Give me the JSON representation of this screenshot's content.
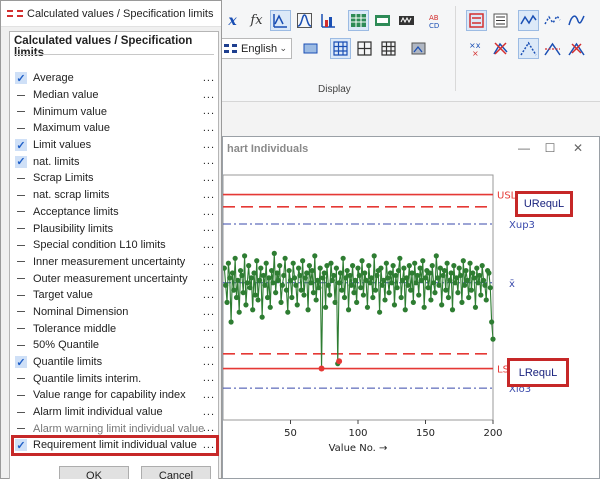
{
  "dialog": {
    "title": "Calculated values / Specification limits",
    "heading": "Calculated values / Specification limits",
    "more_glyph": "...",
    "options": [
      {
        "label": "Average",
        "checked": true
      },
      {
        "label": "Median value",
        "checked": false
      },
      {
        "label": "Minimum value",
        "checked": false
      },
      {
        "label": "Maximum value",
        "checked": false
      },
      {
        "label": "Limit values",
        "checked": true
      },
      {
        "label": "nat. limits",
        "checked": true
      },
      {
        "label": "Scrap Limits",
        "checked": false
      },
      {
        "label": "nat. scrap limits",
        "checked": false
      },
      {
        "label": "Acceptance limits",
        "checked": false
      },
      {
        "label": "Plausibility limits",
        "checked": false
      },
      {
        "label": "Special condition L10 limits",
        "checked": false
      },
      {
        "label": "Inner measurement uncertainty",
        "checked": false
      },
      {
        "label": "Outer measurement uncertainty",
        "checked": false
      },
      {
        "label": "Target value",
        "checked": false
      },
      {
        "label": "Nominal Dimension",
        "checked": false
      },
      {
        "label": "Tolerance middle",
        "checked": false
      },
      {
        "label": "50% Quantile",
        "checked": false
      },
      {
        "label": "Quantile limits",
        "checked": true
      },
      {
        "label": "Quantile limits interim.",
        "checked": false
      },
      {
        "label": "Value range for capability index",
        "checked": false
      },
      {
        "label": "Alarm limit individual value",
        "checked": false
      },
      {
        "label": "Alarm warning limit individual value",
        "checked": false
      },
      {
        "label": "Requirement limit individual value",
        "checked": true
      }
    ],
    "ok_label": "OK",
    "cancel_label": "Cancel"
  },
  "ribbon": {
    "language": "English",
    "group_label": "Display",
    "x_label": "x",
    "fx_label": "fx"
  },
  "chart_window": {
    "title": "hart Individuals",
    "minimize": "—",
    "maximize": "☐",
    "close": "✕"
  },
  "callouts": {
    "upper": "URequL",
    "lower": "LRequL"
  },
  "chart_data": {
    "type": "line",
    "xlabel": "Value No. →",
    "x_ticks": [
      50,
      100,
      150,
      200
    ],
    "xlim": [
      0,
      200
    ],
    "ylim": [
      0,
      100
    ],
    "lines": [
      {
        "label": "USL",
        "y": 92,
        "style": "solid",
        "color": "#e53935"
      },
      {
        "label": "",
        "y": 87,
        "style": "dashed",
        "color": "#e53935"
      },
      {
        "label": "Xup3",
        "y": 80,
        "style": "dashdot",
        "color": "#3949ab"
      },
      {
        "label": "x̄",
        "y": 56,
        "style": "dashdot",
        "color": "#3949ab"
      },
      {
        "label": "",
        "y": 27,
        "style": "dashed",
        "color": "#e53935"
      },
      {
        "label": "LSL",
        "y": 21,
        "style": "solid",
        "color": "#e53935"
      },
      {
        "label": "Xlo3",
        "y": 13,
        "style": "dashdot",
        "color": "#3949ab"
      }
    ],
    "series": [
      {
        "name": "",
        "color": "#2e7d32",
        "values": [
          62,
          55,
          48,
          64,
          58,
          40,
          60,
          53,
          66,
          50,
          57,
          44,
          61,
          59,
          52,
          67,
          47,
          56,
          63,
          54,
          58,
          45,
          60,
          51,
          65,
          49,
          57,
          62,
          42,
          59,
          55,
          64,
          50,
          58,
          46,
          61,
          56,
          68,
          52,
          60,
          57,
          63,
          48,
          55,
          59,
          66,
          53,
          44,
          61,
          57,
          50,
          64,
          58,
          55,
          47,
          62,
          59,
          53,
          65,
          51,
          58,
          60,
          45,
          63,
          56,
          61,
          52,
          67,
          49,
          57,
          54,
          62,
          21,
          58,
          60,
          46,
          63,
          55,
          51,
          64,
          57,
          59,
          48,
          62,
          23,
          56,
          60,
          53,
          66,
          50,
          58,
          61,
          45,
          59,
          55,
          63,
          52,
          57,
          48,
          62,
          59,
          54,
          65,
          51,
          60,
          57,
          46,
          63,
          56,
          58,
          50,
          67,
          53,
          59,
          61,
          44,
          62,
          55,
          57,
          49,
          64,
          58,
          52,
          60,
          56,
          63,
          47,
          59,
          54,
          61,
          66,
          50,
          57,
          62,
          45,
          58,
          55,
          63,
          53,
          60,
          48,
          64,
          56,
          59,
          51,
          62,
          57,
          65,
          46,
          58,
          61,
          54,
          60,
          49,
          63,
          56,
          52,
          67,
          58,
          55,
          62,
          47,
          59,
          61,
          53,
          64,
          50,
          57,
          60,
          45,
          63,
          56,
          58,
          52,
          62,
          59,
          48,
          65,
          55,
          61,
          57,
          50,
          64,
          53,
          60,
          58,
          46,
          62,
          56,
          59,
          51,
          63,
          57,
          55,
          49,
          61,
          60,
          54,
          40,
          33
        ]
      },
      {
        "name": "",
        "color": "#e53935",
        "values": [
          24
        ]
      }
    ]
  }
}
